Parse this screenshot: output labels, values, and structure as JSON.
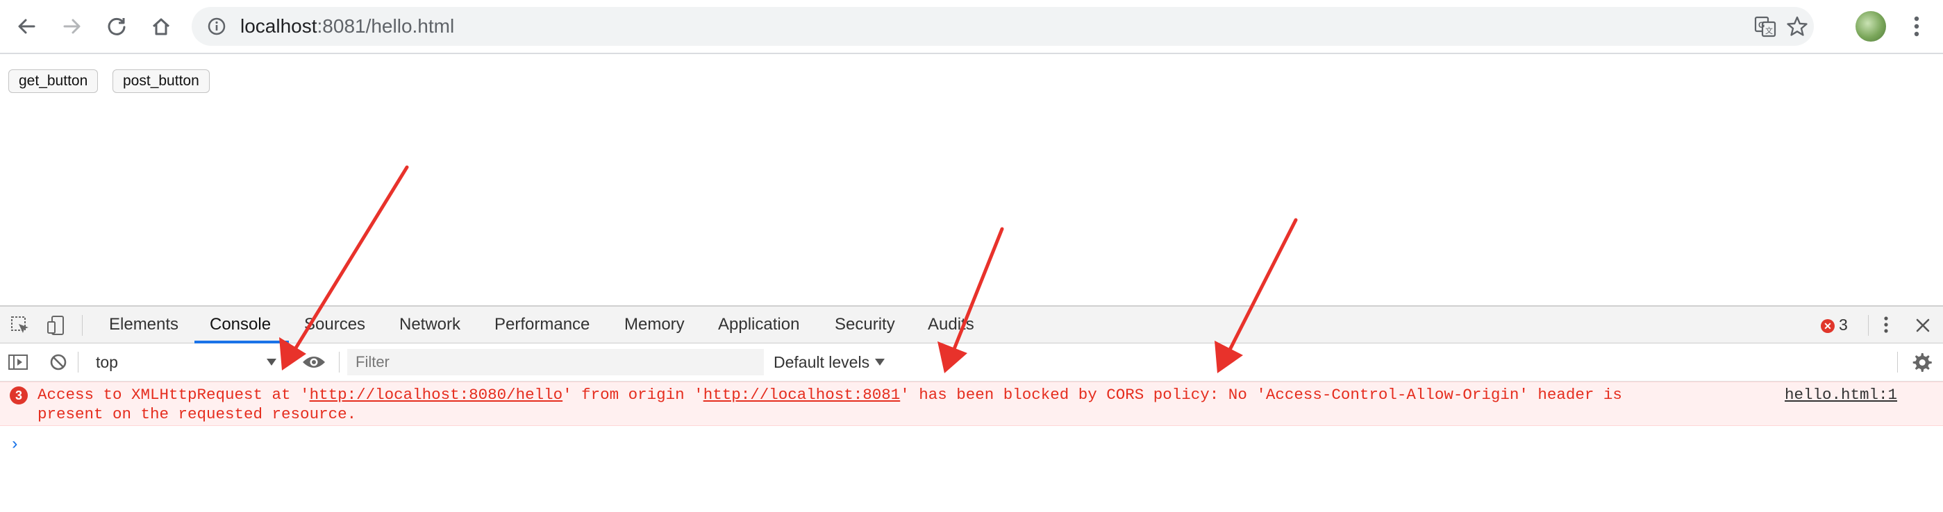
{
  "browser": {
    "url_host": "localhost",
    "url_rest": ":8081/hello.html"
  },
  "page": {
    "buttons": [
      {
        "label": "get_button"
      },
      {
        "label": "post_button"
      }
    ]
  },
  "devtools": {
    "tabs": [
      {
        "label": "Elements",
        "active": false
      },
      {
        "label": "Console",
        "active": true
      },
      {
        "label": "Sources",
        "active": false
      },
      {
        "label": "Network",
        "active": false
      },
      {
        "label": "Performance",
        "active": false
      },
      {
        "label": "Memory",
        "active": false
      },
      {
        "label": "Application",
        "active": false
      },
      {
        "label": "Security",
        "active": false
      },
      {
        "label": "Audits",
        "active": false
      }
    ],
    "error_count": "3",
    "console": {
      "context": "top",
      "filter_placeholder": "Filter",
      "levels": "Default levels"
    },
    "error_message": {
      "count_badge": "3",
      "part1": "Access to XMLHttpRequest at '",
      "link1": "http://localhost:8080/hello",
      "part2": "' from origin '",
      "link2": "http://localhost:8081",
      "part3": "' has been blocked by CORS policy: No 'Access-Control-Allow-Origin' header is",
      "line2": "present on the requested resource.",
      "source": "hello.html:1"
    },
    "prompt": "›"
  },
  "colors": {
    "error_red": "#e52d1e",
    "annotation_red": "#e8322b",
    "active_tab_blue": "#1a73e8"
  }
}
